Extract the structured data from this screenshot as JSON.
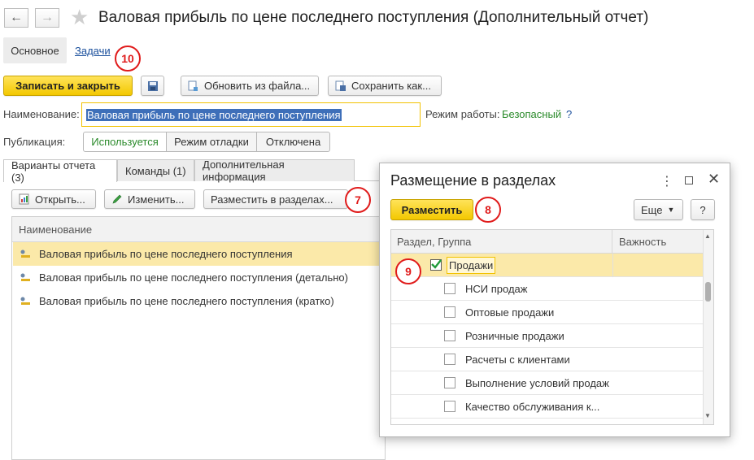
{
  "window": {
    "title": "Валовая прибыль по цене последнего поступления (Дополнительный отчет)"
  },
  "nav": {
    "main_label": "Основное",
    "tasks_link": "Задачи"
  },
  "toolbar": {
    "save_close": "Записать и закрыть",
    "update_from_file": "Обновить из файла...",
    "save_as": "Сохранить как..."
  },
  "form": {
    "name_label": "Наименование:",
    "name_value": "Валовая прибыль по цене последнего поступления",
    "mode_label": "Режим работы:",
    "mode_value": "Безопасный",
    "help_mark": "?",
    "publication_label": "Публикация:",
    "publication_options": [
      "Используется",
      "Режим отладки",
      "Отключена"
    ]
  },
  "tabs": [
    {
      "label": "Варианты отчета (3)"
    },
    {
      "label": "Команды (1)"
    },
    {
      "label": "Дополнительная информация"
    }
  ],
  "variants_toolbar": {
    "open": "Открыть...",
    "edit": "Изменить...",
    "place": "Разместить в разделах..."
  },
  "variants_table": {
    "column_header": "Наименование",
    "rows": [
      "Валовая прибыль по цене последнего поступления",
      "Валовая прибыль по цене последнего поступления (детально)",
      "Валовая прибыль по цене последнего поступления (кратко)"
    ]
  },
  "dialog": {
    "title": "Размещение в разделах",
    "place_button": "Разместить",
    "more_button": "Еще",
    "help_button": "?",
    "col_section": "Раздел, Группа",
    "col_importance": "Важность",
    "items": [
      {
        "label": "Продажи",
        "checked": true
      },
      {
        "label": "НСИ продаж",
        "checked": false
      },
      {
        "label": "Оптовые продажи",
        "checked": false
      },
      {
        "label": "Розничные продажи",
        "checked": false
      },
      {
        "label": "Расчеты с клиентами",
        "checked": false
      },
      {
        "label": "Выполнение условий продаж",
        "checked": false
      },
      {
        "label": "Качество обслуживания к...",
        "checked": false
      }
    ]
  },
  "markers": [
    "10",
    "7",
    "8",
    "9"
  ],
  "colors": {
    "accent_yellow": "#f5cc00",
    "selection_row": "#fbe9a9",
    "link": "#1a4f9c",
    "safe_green": "#2a8a2a",
    "marker_red": "#e01b1b"
  }
}
